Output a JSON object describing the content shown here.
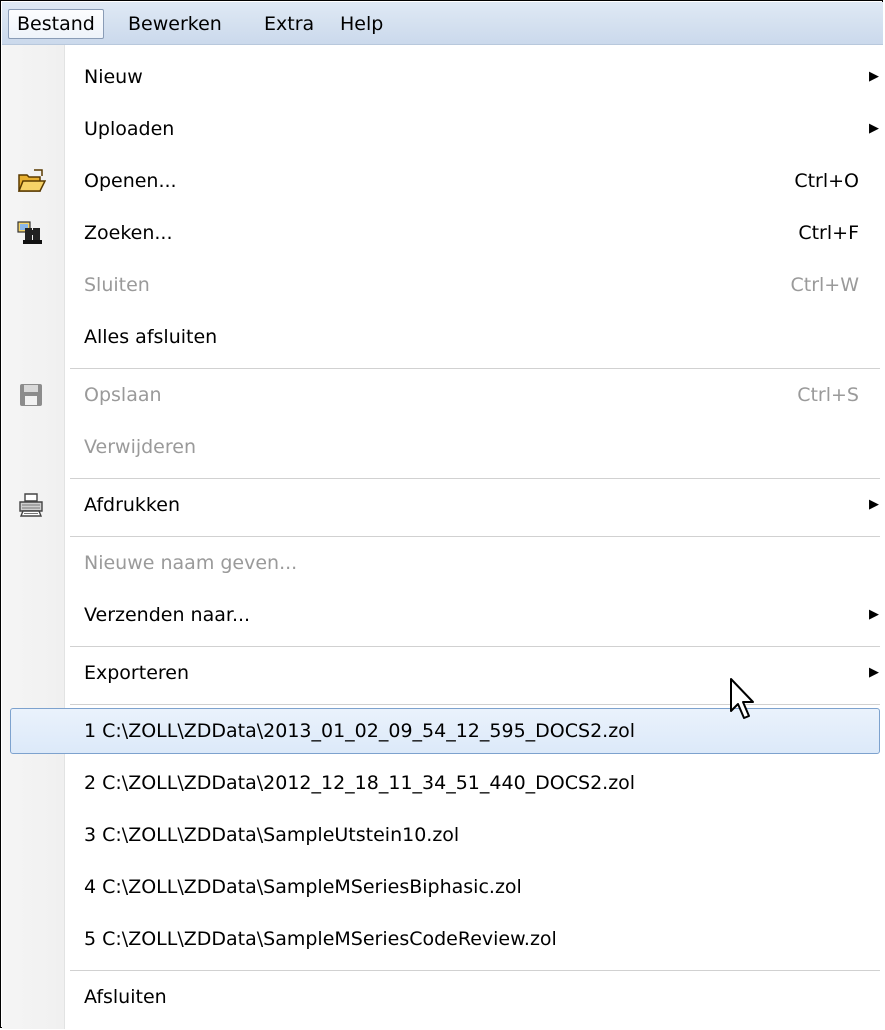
{
  "menubar": {
    "items": [
      "Bestand",
      "Bewerken",
      "Extra",
      "Help"
    ]
  },
  "menu": {
    "nieuw": {
      "label": "Nieuw"
    },
    "uploaden": {
      "label": "Uploaden"
    },
    "openen": {
      "label": "Openen...",
      "shortcut": "Ctrl+O",
      "icon": "folder-open-icon"
    },
    "zoeken": {
      "label": "Zoeken...",
      "shortcut": "Ctrl+F",
      "icon": "binoculars-icon"
    },
    "sluiten": {
      "label": "Sluiten",
      "shortcut": "Ctrl+W"
    },
    "alles_afsluiten": {
      "label": "Alles afsluiten"
    },
    "opslaan": {
      "label": "Opslaan",
      "shortcut": "Ctrl+S",
      "icon": "floppy-disk-icon"
    },
    "verwijderen": {
      "label": "Verwijderen"
    },
    "afdrukken": {
      "label": "Afdrukken",
      "icon": "printer-icon"
    },
    "nieuwe_naam": {
      "label": "Nieuwe naam geven..."
    },
    "verzenden": {
      "label": "Verzenden naar..."
    },
    "exporteren": {
      "label": "Exporteren"
    },
    "recent": [
      {
        "label": "1 C:\\ZOLL\\ZDData\\2013_01_02_09_54_12_595_DOCS2.zol"
      },
      {
        "label": "2 C:\\ZOLL\\ZDData\\2012_12_18_11_34_51_440_DOCS2.zol"
      },
      {
        "label": "3 C:\\ZOLL\\ZDData\\SampleUtstein10.zol"
      },
      {
        "label": "4 C:\\ZOLL\\ZDData\\SampleMSeriesBiphasic.zol"
      },
      {
        "label": "5 C:\\ZOLL\\ZDData\\SampleMSeriesCodeReview.zol"
      }
    ],
    "afsluiten": {
      "label": "Afsluiten"
    },
    "submenu_arrow": "▶"
  },
  "colors": {
    "disabled_text": "#9a9a9a",
    "hover_border": "#7da2ce",
    "hover_fill": "#dce9f9"
  }
}
